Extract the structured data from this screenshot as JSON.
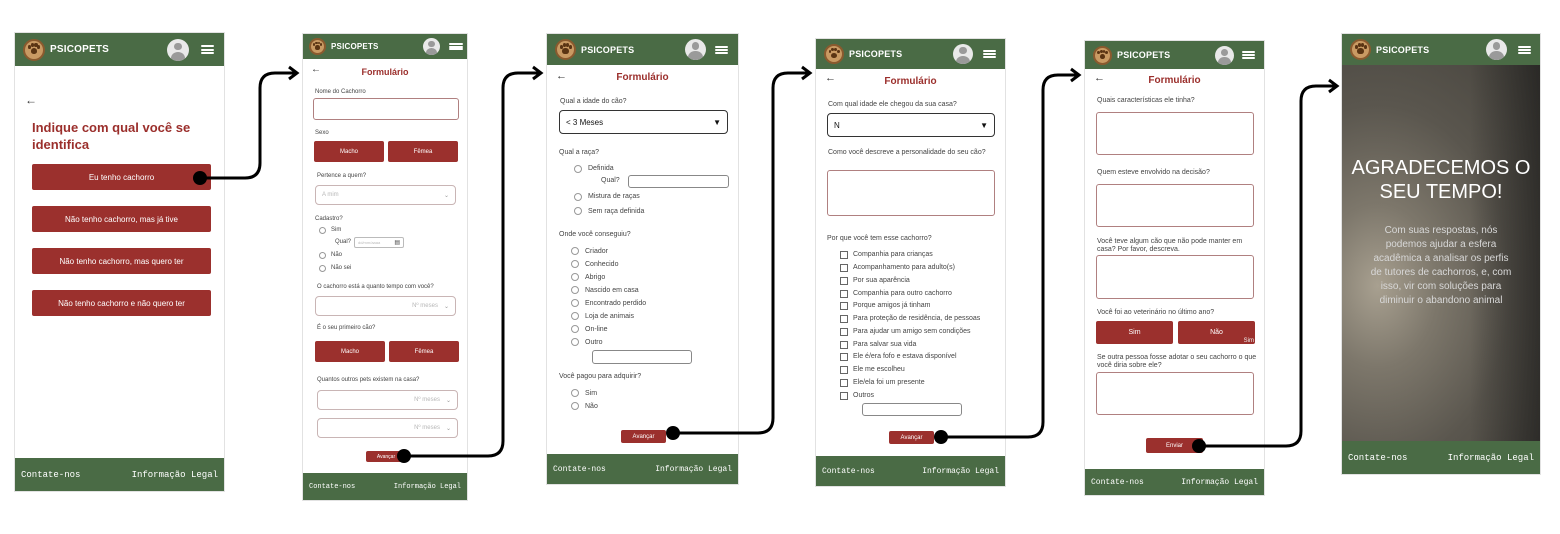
{
  "brand": {
    "name": "PSICOPETS"
  },
  "footer": {
    "contact": "Contate-nos",
    "legal": "Informação Legal"
  },
  "screen1": {
    "question": "Indique com qual você se identifica",
    "options": [
      "Eu tenho cachorro",
      "Não tenho cachorro, mas já tive",
      "Não tenho cachorro, mas quero ter",
      "Não tenho cachorro e não quero ter"
    ]
  },
  "screen2": {
    "title": "Formulário",
    "dog_name_label": "Nome  do Cachorro",
    "sex_label": "Sexo",
    "male": "Macho",
    "female": "Fêmea",
    "belongs_label": "Pertence a quem?",
    "belongs_placeholder": "A mim",
    "registered_label": "Cadastro?",
    "yes": "Sim",
    "which": "Qual?",
    "date_placeholder": "dd/mm/aaaa",
    "no": "Não",
    "dont_know": "Não sei",
    "time_label": "O cachorro está a quanto tempo com você?",
    "months_placeholder": "Nº meses",
    "first_dog_label": "É o seu primeiro cão?",
    "male2": "Macho",
    "female2": "Fêmea",
    "other_pets_label": "Quantos outros pets existem na casa?",
    "select_a": "Nº meses",
    "select_b": "Nº meses",
    "next": "Avançar"
  },
  "screen3": {
    "title": "Formulário",
    "age_label": "Qual a idade do cão?",
    "age_value": "< 3 Meses",
    "breed_label": "Qual a raça?",
    "breed_options": [
      "Definida",
      "Mistura de raças",
      "Sem raça definida"
    ],
    "breed_which": "Qual?",
    "source_label": "Onde você conseguiu?",
    "source_options": [
      "Criador",
      "Conhecido",
      "Abrigo",
      "Nascido em casa",
      "Encontrado perdido",
      "Loja de animais",
      "On-line",
      "Outro"
    ],
    "paid_label": "Você pagou para adquirir?",
    "paid_options": [
      "Sim",
      "Não"
    ],
    "next": "Avançar"
  },
  "screen4": {
    "title": "Formulário",
    "age_label": "Com qual idade ele chegou da sua casa?",
    "age_value": "N",
    "personality_label": "Como você descreve a personalidade do seu cão?",
    "why_label": "Por que você tem esse cachorro?",
    "why_options": [
      "Companhia para crianças",
      "Acompanhamento para adulto(s)",
      "Por sua aparência",
      "Companhia para outro cachorro",
      "Porque amigos já tinham",
      "Para proteção de residência, de pessoas",
      "Para ajudar um amigo sem condições",
      "Para salvar sua vida",
      "Ele é/era fofo e estava disponível",
      "Ele me escolheu",
      "Ele/ela foi um presente",
      "Outros"
    ],
    "next": "Avançar"
  },
  "screen5": {
    "title": "Formulário",
    "traits_label": "Quais características ele tinha?",
    "involved_label": "Quem esteve envolvido na decisão?",
    "lost_dog_label": "Você teve algum cão que não pode manter em casa? Por favor, descreva.",
    "vet_label": "Você foi ao veterinário no último ano?",
    "yes": "Sim",
    "no": "Não",
    "stray_text": "Sim",
    "adopt_label": "Se outra pessoa fosse adotar o seu cachorro o que você diria sobre ele?",
    "send": "Enviar"
  },
  "screen6": {
    "thanks": "AGRADECEMOS O SEU TEMPO!",
    "message": "Com suas respostas, nós podemos ajudar a esfera acadêmica a analisar os perfis de tutores de cachorros, e, com isso, vir com soluções para diminuir o abandono animal"
  },
  "colors": {
    "header_green": "#4a6b45",
    "accent_red": "#9b302d",
    "title_red": "#9b2f2c"
  },
  "icons": [
    "paw-logo-icon",
    "user-avatar-icon",
    "hamburger-menu-icon",
    "back-arrow-icon",
    "calendar-icon",
    "chevron-down-icon"
  ]
}
